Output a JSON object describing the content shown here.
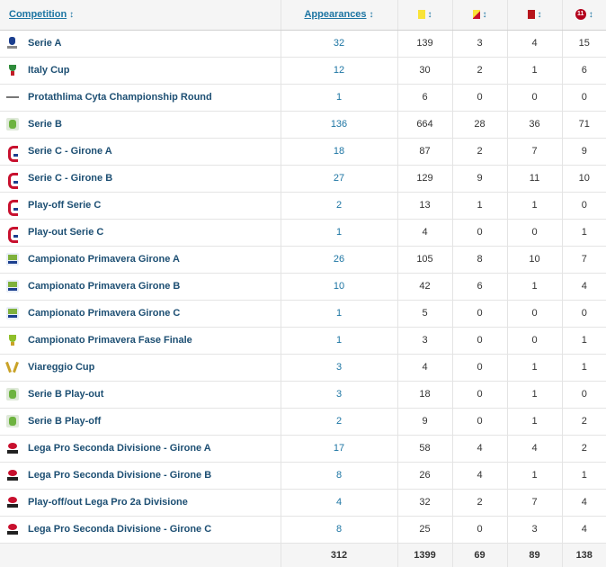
{
  "header": {
    "competition": "Competition",
    "appearances": "Appearances",
    "sort_glyph": "↕",
    "goals_icon_text": "11"
  },
  "colors": {
    "link": "#1d75a3",
    "name": "#1d4f73",
    "yellow_card": "#f9e338",
    "red_card": "#b7151c",
    "goal_badge": "#b3001b"
  },
  "rows": [
    {
      "logo": "serie-a-logo",
      "name": "Serie A",
      "apps": "32",
      "yellow": "139",
      "yellow_red": "3",
      "red": "4",
      "goals": "15"
    },
    {
      "logo": "italy-cup-logo",
      "name": "Italy Cup",
      "apps": "12",
      "yellow": "30",
      "yellow_red": "2",
      "red": "1",
      "goals": "6"
    },
    {
      "logo": "cyta-championship-logo",
      "name": "Protathlima Cyta Championship Round",
      "apps": "1",
      "yellow": "6",
      "yellow_red": "0",
      "red": "0",
      "goals": "0"
    },
    {
      "logo": "serie-b-logo",
      "name": "Serie B",
      "apps": "136",
      "yellow": "664",
      "yellow_red": "28",
      "red": "36",
      "goals": "71"
    },
    {
      "logo": "serie-c-logo",
      "name": "Serie C - Girone A",
      "apps": "18",
      "yellow": "87",
      "yellow_red": "2",
      "red": "7",
      "goals": "9"
    },
    {
      "logo": "serie-c-logo",
      "name": "Serie C - Girone B",
      "apps": "27",
      "yellow": "129",
      "yellow_red": "9",
      "red": "11",
      "goals": "10"
    },
    {
      "logo": "serie-c-logo",
      "name": "Play-off Serie C",
      "apps": "2",
      "yellow": "13",
      "yellow_red": "1",
      "red": "1",
      "goals": "0"
    },
    {
      "logo": "serie-c-logo",
      "name": "Play-out Serie C",
      "apps": "1",
      "yellow": "4",
      "yellow_red": "0",
      "red": "0",
      "goals": "1"
    },
    {
      "logo": "primavera-logo",
      "name": "Campionato Primavera Girone A",
      "apps": "26",
      "yellow": "105",
      "yellow_red": "8",
      "red": "10",
      "goals": "7"
    },
    {
      "logo": "primavera-logo",
      "name": "Campionato Primavera Girone B",
      "apps": "10",
      "yellow": "42",
      "yellow_red": "6",
      "red": "1",
      "goals": "4"
    },
    {
      "logo": "primavera-logo",
      "name": "Campionato Primavera Girone C",
      "apps": "1",
      "yellow": "5",
      "yellow_red": "0",
      "red": "0",
      "goals": "0"
    },
    {
      "logo": "primavera-final-logo",
      "name": "Campionato Primavera Fase Finale",
      "apps": "1",
      "yellow": "3",
      "yellow_red": "0",
      "red": "0",
      "goals": "1"
    },
    {
      "logo": "viareggio-cup-logo",
      "name": "Viareggio Cup",
      "apps": "3",
      "yellow": "4",
      "yellow_red": "0",
      "red": "1",
      "goals": "1"
    },
    {
      "logo": "serie-b-logo",
      "name": "Serie B Play-out",
      "apps": "3",
      "yellow": "18",
      "yellow_red": "0",
      "red": "1",
      "goals": "0"
    },
    {
      "logo": "serie-b-logo",
      "name": "Serie B Play-off",
      "apps": "2",
      "yellow": "9",
      "yellow_red": "0",
      "red": "1",
      "goals": "2"
    },
    {
      "logo": "lega-pro-logo",
      "name": "Lega Pro Seconda Divisione - Girone A",
      "apps": "17",
      "yellow": "58",
      "yellow_red": "4",
      "red": "4",
      "goals": "2"
    },
    {
      "logo": "lega-pro-logo",
      "name": "Lega Pro Seconda Divisione - Girone B",
      "apps": "8",
      "yellow": "26",
      "yellow_red": "4",
      "red": "1",
      "goals": "1"
    },
    {
      "logo": "lega-pro-logo",
      "name": "Play-off/out Lega Pro 2a Divisione",
      "apps": "4",
      "yellow": "32",
      "yellow_red": "2",
      "red": "7",
      "goals": "4"
    },
    {
      "logo": "lega-pro-logo",
      "name": "Lega Pro Seconda Divisione - Girone C",
      "apps": "8",
      "yellow": "25",
      "yellow_red": "0",
      "red": "3",
      "goals": "4"
    }
  ],
  "totals": {
    "apps": "312",
    "yellow": "1399",
    "yellow_red": "69",
    "red": "89",
    "goals": "138"
  }
}
